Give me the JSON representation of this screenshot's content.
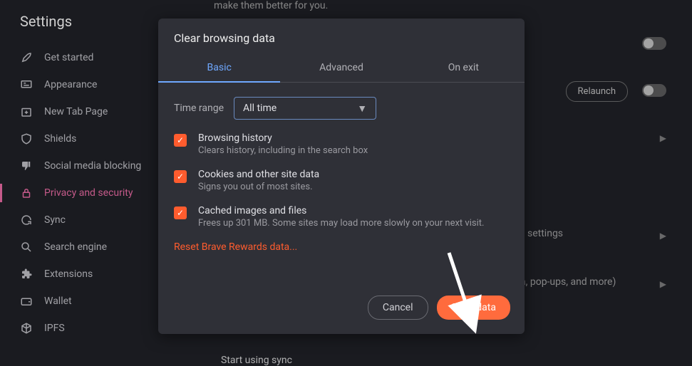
{
  "sidebar": {
    "title": "Settings",
    "items": [
      {
        "label": "Get started"
      },
      {
        "label": "Appearance"
      },
      {
        "label": "New Tab Page"
      },
      {
        "label": "Shields"
      },
      {
        "label": "Social media blocking"
      },
      {
        "label": "Privacy and security"
      },
      {
        "label": "Sync"
      },
      {
        "label": "Search engine"
      },
      {
        "label": "Extensions"
      },
      {
        "label": "Wallet"
      },
      {
        "label": "IPFS"
      }
    ]
  },
  "background": {
    "top_text": "make them better for you.",
    "relaunch": "Relaunch",
    "settings_text": "settings",
    "popups_text": "a, pop-ups, and more)",
    "sync_text": "Start using sync"
  },
  "modal": {
    "title": "Clear browsing data",
    "tabs": [
      {
        "label": "Basic"
      },
      {
        "label": "Advanced"
      },
      {
        "label": "On exit"
      }
    ],
    "time_range_label": "Time range",
    "time_range_value": "All time",
    "checks": [
      {
        "title": "Browsing history",
        "desc": "Clears history, including in the search box"
      },
      {
        "title": "Cookies and other site data",
        "desc": "Signs you out of most sites."
      },
      {
        "title": "Cached images and files",
        "desc": "Frees up 301 MB. Some sites may load more slowly on your next visit."
      }
    ],
    "reset_link": "Reset Brave Rewards data...",
    "cancel": "Cancel",
    "clear": "Clear data"
  }
}
